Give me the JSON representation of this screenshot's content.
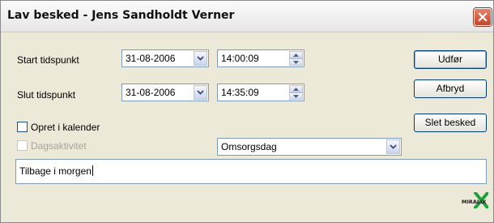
{
  "window": {
    "title": "Lav besked - Jens Sandholdt Verner"
  },
  "start": {
    "label": "Start tidspunkt",
    "date": "31-08-2006",
    "time": "14:00:09"
  },
  "slut": {
    "label": "Slut tidspunkt",
    "date": "31-08-2006",
    "time": "14:35:09"
  },
  "buttons": {
    "udfor": "Udfør",
    "afbryd": "Afbryd",
    "slet": "Slet besked"
  },
  "opret_kalender": {
    "label": "Opret i kalender",
    "checked": false
  },
  "dagsaktivitet": {
    "label": "Dagsaktivitet",
    "checked": false,
    "enabled": false
  },
  "kategori": {
    "selected": "Omsorgsdag"
  },
  "besked": {
    "value": "Tilbage i morgen"
  },
  "logo": {
    "text": "MIRALIX"
  },
  "icons": {
    "close": "close-icon",
    "dropdown": "chevron-down-icon",
    "spinner": "spinner-arrows-icon"
  },
  "colors": {
    "close_red": "#c6442a",
    "border_blue": "#7f9db9",
    "logo_green": "#1fa23a"
  }
}
